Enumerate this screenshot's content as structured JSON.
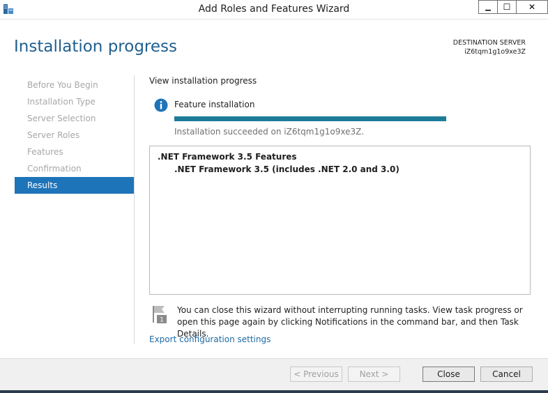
{
  "window": {
    "title": "Add Roles and Features Wizard",
    "minimize_glyph": "▁",
    "maximize_glyph": "☐",
    "close_glyph": "✕"
  },
  "header": {
    "title": "Installation progress",
    "destination_label": "DESTINATION SERVER",
    "destination_server": "iZ6tqm1g1o9xe3Z"
  },
  "nav": {
    "items": [
      {
        "label": "Before You Begin",
        "active": false
      },
      {
        "label": "Installation Type",
        "active": false
      },
      {
        "label": "Server Selection",
        "active": false
      },
      {
        "label": "Server Roles",
        "active": false
      },
      {
        "label": "Features",
        "active": false
      },
      {
        "label": "Confirmation",
        "active": false
      },
      {
        "label": "Results",
        "active": true
      }
    ]
  },
  "main": {
    "section_label": "View installation progress",
    "feature_label": "Feature installation",
    "progress_fraction": 1.0,
    "status_text": "Installation succeeded on iZ6tqm1g1o9xe3Z.",
    "results": {
      "parent": ".NET Framework 3.5 Features",
      "child": ".NET Framework 3.5 (includes .NET 2.0 and 3.0)"
    },
    "note_badge": "1",
    "note": "You can close this wizard without interrupting running tasks. View task progress or open this page again by clicking Notifications in the command bar, and then Task Details.",
    "export_link": "Export configuration settings"
  },
  "footer": {
    "previous": "< Previous",
    "next": "Next >",
    "close": "Close",
    "cancel": "Cancel"
  },
  "colors": {
    "accent": "#1e74b9",
    "title": "#1f5f8f",
    "progress": "#1e7c99",
    "link": "#1e6aa6"
  },
  "icons": {
    "app": "server-manager-icon",
    "info": "info-icon",
    "notification": "notification-flag-icon"
  }
}
